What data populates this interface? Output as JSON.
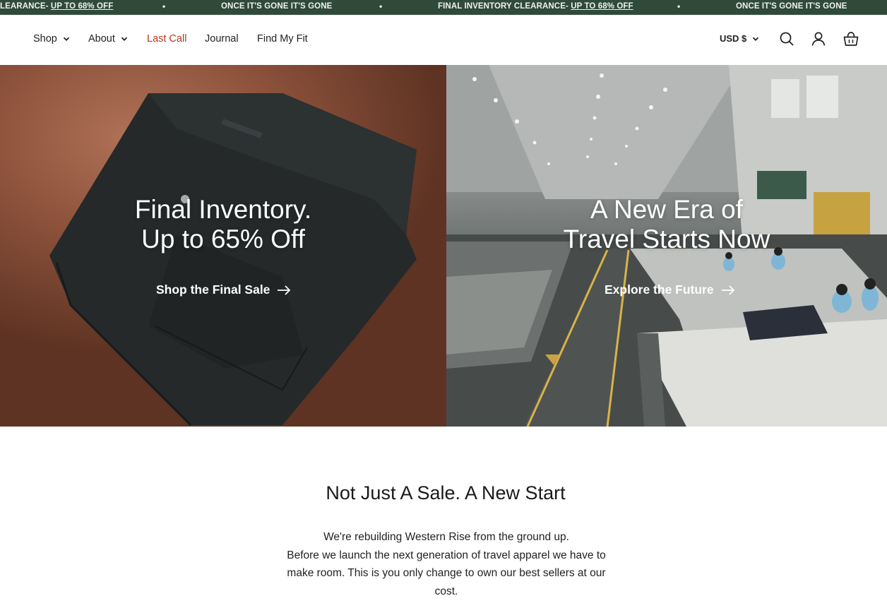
{
  "announcement": {
    "items": [
      {
        "text": "LEARANCE- ",
        "link": "UP TO 68% OFF"
      },
      {
        "text": "ONCE IT'S GONE IT'S GONE"
      },
      {
        "text": "FINAL INVENTORY CLEARANCE- ",
        "link": "UP TO 68% OFF"
      },
      {
        "text": "ONCE IT'S GONE IT'S GONE"
      }
    ],
    "separator": "•",
    "bg_color": "#2f4a39"
  },
  "nav": {
    "items": [
      {
        "label": "Shop",
        "has_dropdown": true
      },
      {
        "label": "About",
        "has_dropdown": true
      },
      {
        "label": "Last Call",
        "highlight": true,
        "color": "#b3371e"
      },
      {
        "label": "Journal"
      },
      {
        "label": "Find My Fit"
      }
    ]
  },
  "utility": {
    "currency": "USD $",
    "icons": [
      "search-icon",
      "account-icon",
      "cart-icon"
    ]
  },
  "hero": {
    "left": {
      "title_line1": "Final Inventory.",
      "title_line2": "Up to 65% Off",
      "cta": "Shop the Final Sale"
    },
    "right": {
      "title_line1": "A New Era of",
      "title_line2": "Travel Starts Now",
      "cta": "Explore the Future"
    }
  },
  "intro": {
    "title": "Not Just A Sale. A New Start",
    "line1": "We're rebuilding Western Rise from the ground up.",
    "line2": "Before we launch the next generation of travel apparel we have to make room. This is you only change to own our best sellers at our cost."
  }
}
